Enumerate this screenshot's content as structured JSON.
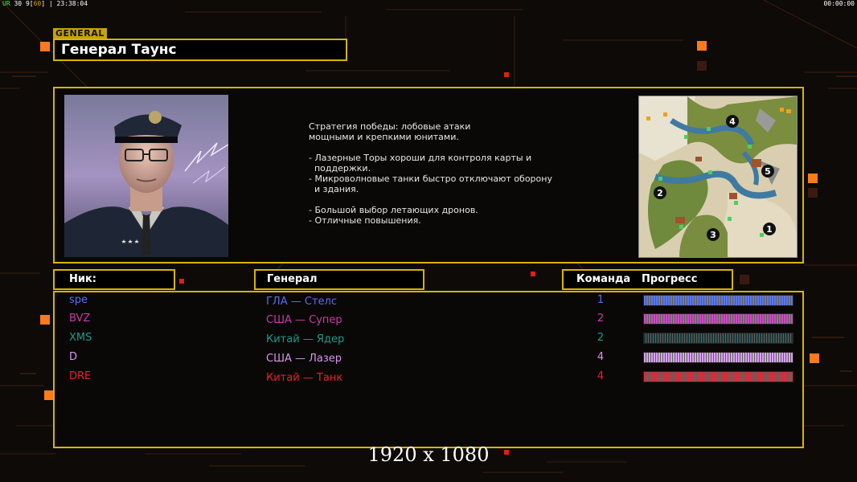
{
  "hud": {
    "top_left_fps_label": "UR",
    "top_left_fps": "30",
    "top_left_frames": "9",
    "top_left_bracket_val": "60",
    "top_left_time": "23:38:04",
    "top_right_time": "00:00:00"
  },
  "general": {
    "tag": "GENERAL",
    "name": "Генерал Таунс"
  },
  "description": {
    "p1_line1": "Стратегия победы: лобовые атаки",
    "p1_line2": "мощными и крепкими юнитами.",
    "b1_line1": "- Лазерные Торы хороши для контроля карты и",
    "b1_line2": "  поддержки.",
    "b2_line1": "- Микроволновые танки быстро отключают оборону",
    "b2_line2": "  и здания.",
    "b3_line1": "- Большой выбор летающих дронов.",
    "b4_line1": "- Отличные повышения."
  },
  "minimap": {
    "labels": [
      "4",
      "5",
      "2",
      "3",
      "1"
    ]
  },
  "headers": {
    "nick": "Ник:",
    "general": "Генерал",
    "team": "Команда",
    "progress": "Прогресс"
  },
  "players": [
    {
      "nick": "spe",
      "general": "ГЛА — Стелс",
      "team": "1",
      "progress": 1.0,
      "color": "#5a6cf5",
      "bar_color": "#5b78e8"
    },
    {
      "nick": "BVZ",
      "general": "США — Супер",
      "team": "2",
      "progress": 1.0,
      "color": "#c93aa8",
      "bar_color": "#c84fbf"
    },
    {
      "nick": "XMS",
      "general": "Китай — Ядер",
      "team": "2",
      "progress": 1.0,
      "color": "#1f9a8e",
      "bar_color": "#1c3838"
    },
    {
      "nick": "D",
      "general": "США — Лазер",
      "team": "4",
      "progress": 1.0,
      "color": "#d895ee",
      "bar_color": "#d9a3f0"
    },
    {
      "nick": "DRE",
      "general": "Китай — Танк",
      "team": "4",
      "progress": 1.0,
      "color": "#e8222c",
      "bar_color": "#d4303a"
    }
  ],
  "footer": {
    "resolution": "1920 x 1080"
  },
  "colors": {
    "accent": "#d8b400",
    "orange_square": "#ff7a1a",
    "red_square": "#e02010"
  }
}
